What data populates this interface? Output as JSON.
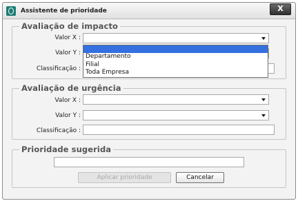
{
  "window": {
    "title": "Assistente de prioridade",
    "close_label": "X"
  },
  "impact": {
    "legend": "Avaliação de impacto",
    "valor_x_label": "Valor X :",
    "valor_y_label": "Valor Y :",
    "classificacao_label": "Classificação :",
    "dropdown_options": [
      "",
      "Departamento",
      "Filial",
      "Toda Empresa"
    ]
  },
  "urgency": {
    "legend": "Avaliação de urgência",
    "valor_x_label": "Valor X :",
    "valor_y_label": "Valor Y :",
    "classificacao_label": "Classificação :"
  },
  "priority": {
    "legend": "Prioridade sugerida",
    "apply_label": "Aplicar prioridade",
    "cancel_label": "Cancelar"
  }
}
